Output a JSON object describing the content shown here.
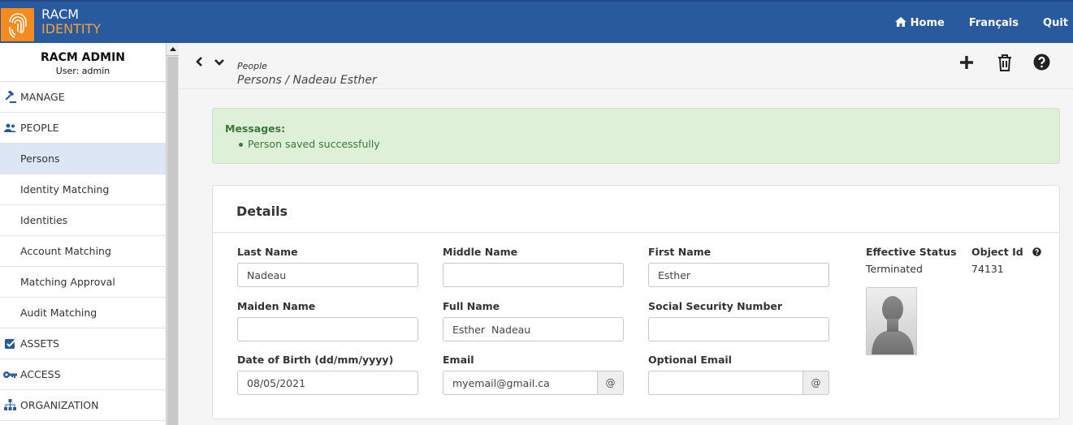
{
  "topbar": {
    "logo_line1": "RACM",
    "logo_line2": "IDENTITY",
    "nav": [
      {
        "label": "Home"
      },
      {
        "label": "Français"
      },
      {
        "label": "Quit"
      }
    ]
  },
  "sidebar": {
    "title": "RACM ADMIN",
    "user": "User: admin",
    "items": [
      {
        "label": "MANAGE",
        "icon": "gavel-icon"
      },
      {
        "label": "PEOPLE",
        "icon": "people-icon"
      },
      {
        "label": "Persons"
      },
      {
        "label": "Identity Matching"
      },
      {
        "label": "Identities"
      },
      {
        "label": "Account Matching"
      },
      {
        "label": "Matching Approval"
      },
      {
        "label": "Audit Matching"
      },
      {
        "label": "ASSETS",
        "icon": "checkbox-icon"
      },
      {
        "label": "ACCESS",
        "icon": "key-icon"
      },
      {
        "label": "ORGANIZATION",
        "icon": "org-chart-icon"
      }
    ]
  },
  "breadcrumb": {
    "section": "People",
    "path": "Persons / Nadeau Esther"
  },
  "messages": {
    "title": "Messages:",
    "items": [
      "Person saved successfully"
    ]
  },
  "details": {
    "title": "Details",
    "last_name": {
      "label": "Last Name",
      "value": "Nadeau"
    },
    "middle_name": {
      "label": "Middle Name",
      "value": ""
    },
    "first_name": {
      "label": "First Name",
      "value": "Esther"
    },
    "maiden_name": {
      "label": "Maiden Name",
      "value": ""
    },
    "full_name": {
      "label": "Full Name",
      "value": "Esther  Nadeau"
    },
    "ssn": {
      "label": "Social Security Number",
      "value": ""
    },
    "dob": {
      "label": "Date of Birth (dd/mm/yyyy)",
      "value": "08/05/2021"
    },
    "email": {
      "label": "Email",
      "value": "myemail@gmail.ca",
      "addon": "@"
    },
    "optional_email": {
      "label": "Optional Email",
      "value": "",
      "addon": "@"
    },
    "effective_status": {
      "label": "Effective Status",
      "value": "Terminated"
    },
    "object_id": {
      "label": "Object Id",
      "value": "74131"
    }
  },
  "colors": {
    "topbar": "#2a5a9e",
    "logo_orange": "#f58a1f",
    "message_bg": "#dff0d8",
    "message_text": "#3c763d",
    "active_item": "#dde6f5"
  }
}
